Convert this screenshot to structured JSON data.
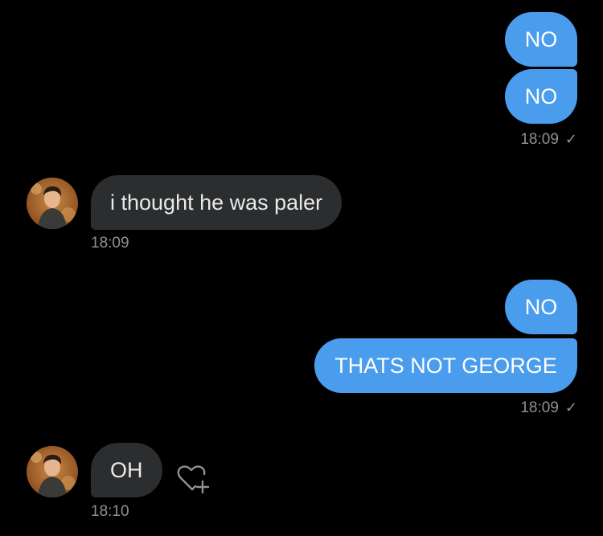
{
  "conversation": {
    "messages": [
      {
        "direction": "sent",
        "text": "NO"
      },
      {
        "direction": "sent",
        "text": "NO"
      },
      {
        "direction": "received",
        "text": "i thought he was paler"
      },
      {
        "direction": "sent",
        "text": "NO"
      },
      {
        "direction": "sent",
        "text": "THATS NOT GEORGE"
      },
      {
        "direction": "received",
        "text": "OH"
      }
    ],
    "timestamps": {
      "group1": "18:09",
      "group2": "18:09",
      "group3": "18:09",
      "group4": "18:10"
    },
    "read_mark": "✓"
  },
  "icons": {
    "avatar": "avatar",
    "heart_plus": "heart-plus-icon",
    "check": "check-icon"
  },
  "colors": {
    "background": "#000000",
    "sent_bubble": "#4a9ded",
    "received_bubble": "#2b2d2f",
    "timestamp": "#8d9195"
  }
}
